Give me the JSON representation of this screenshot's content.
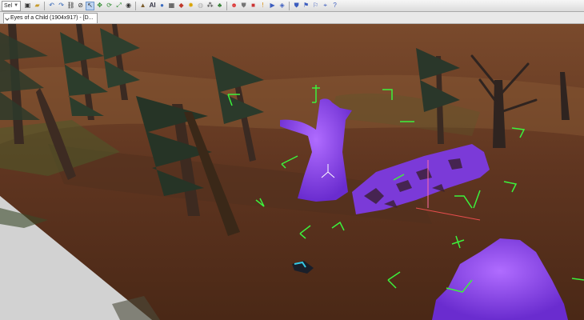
{
  "toolbar": {
    "select_value": "Sel",
    "icons": [
      "save-icon",
      "open-folder-icon",
      "undo-icon",
      "redo-icon",
      "link-icon",
      "unlink-icon",
      "select-cursor-icon",
      "move-icon",
      "rotate-icon",
      "scale-icon",
      "camera-icon",
      "terrain-icon",
      "ai-icon",
      "globe-icon",
      "grid-icon",
      "physics-icon",
      "light-icon",
      "material-icon",
      "particle-icon",
      "vegetation-icon",
      "character-icon",
      "shield-icon",
      "record-icon",
      "warning-icon",
      "game-mode-icon",
      "profile-icon",
      "layer-icon",
      "flag-icon",
      "flag-alt-icon",
      "snap-icon",
      "help-icon"
    ],
    "ai_label": "AI"
  },
  "tab": {
    "title": "Eyes of a Child (1904x917) - [D..."
  },
  "viewport": {
    "description_colors": {
      "sky": "#d8d8d8",
      "ground": "#6b3a22",
      "selection": "#8a3df0",
      "helper": "#3cf23c"
    }
  }
}
